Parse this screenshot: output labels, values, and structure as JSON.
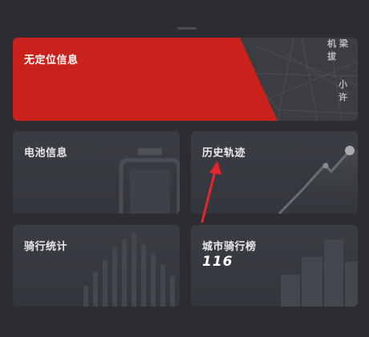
{
  "location_card": {
    "title": "无定位信息",
    "map_label_1": "机 梁 拔",
    "map_label_2": "小 许"
  },
  "battery_card": {
    "title": "电池信息"
  },
  "track_card": {
    "title": "历史轨迹"
  },
  "stats_card": {
    "title": "骑行统计"
  },
  "rank_card": {
    "title": "城市骑行榜",
    "value": "116"
  },
  "colors": {
    "background": "#2b2d33",
    "card": "#3a3c42",
    "alert_red": "#c9221c",
    "annotation_arrow": "#e3262e"
  }
}
